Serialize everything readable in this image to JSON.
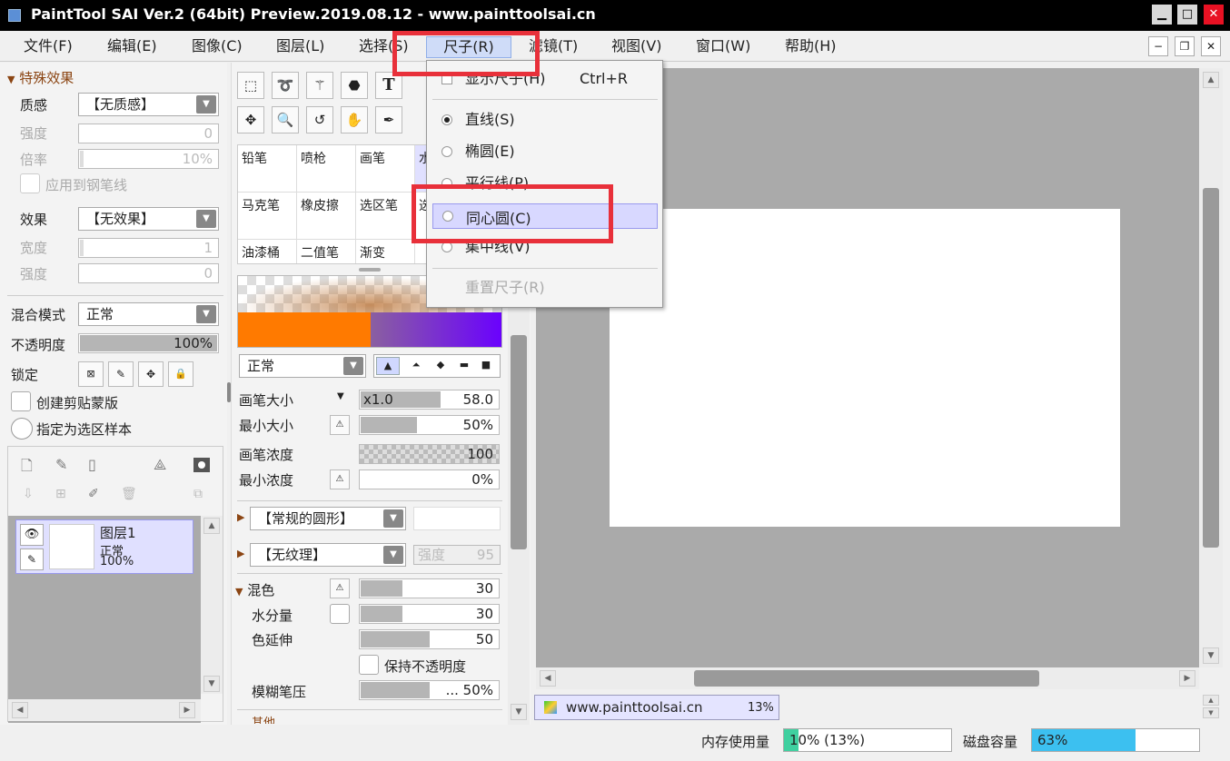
{
  "window": {
    "title": "PaintTool SAI Ver.2 (64bit) Preview.2019.08.12 - www.painttoolsai.cn",
    "min": "▁",
    "max": "□",
    "close": "✕"
  },
  "menu": [
    "文件(F)",
    "编辑(E)",
    "图像(C)",
    "图层(L)",
    "选择(S)",
    "尺子(R)",
    "滤镜(T)",
    "视图(V)",
    "窗口(W)",
    "帮助(H)"
  ],
  "mdi": {
    "min": "−",
    "restore": "❐",
    "close": "✕"
  },
  "effects": {
    "header": "特殊效果",
    "texture_label": "质感",
    "texture_value": "【无质感】",
    "strength_label": "强度",
    "strength_value": "0",
    "rate_label": "倍率",
    "rate_value": "10%",
    "apply_label": "应用到钢笔线",
    "effect_label": "效果",
    "effect_value": "【无效果】",
    "width_label": "宽度",
    "width_value": "1",
    "strength2_label": "强度",
    "strength2_value": "0"
  },
  "layer_props": {
    "blend_label": "混合模式",
    "blend_value": "正常",
    "opacity_label": "不透明度",
    "opacity_value": "100%",
    "opacity_fill": 1.0,
    "lock_label": "锁定",
    "clip_label": "创建剪贴蒙版",
    "select_label": "指定为选区样本"
  },
  "layer": {
    "name": "图层1",
    "mode": "正常",
    "opacity": "100%"
  },
  "tools": [
    "铅笔",
    "喷枪",
    "画笔",
    "水",
    "马克笔",
    "橡皮擦",
    "选区笔",
    "选",
    "油漆桶",
    "二值笔",
    "渐变"
  ],
  "brush": {
    "mode": "正常",
    "size_label": "画笔大小",
    "size_mult": "x1.0",
    "size_value": "58.0",
    "minsize_label": "最小大小",
    "minsize_value": "50%",
    "density_label": "画笔浓度",
    "density_value": "100",
    "mindensity_label": "最小浓度",
    "mindensity_value": "0%",
    "shape": "【常规的圆形】",
    "texture": "【无纹理】",
    "texture_strength_label": "强度",
    "texture_strength": "95",
    "mix_label": "混色",
    "mix_value": "30",
    "water_label": "水分量",
    "water_value": "30",
    "stretch_label": "色延伸",
    "stretch_value": "50",
    "keep_opacity_label": "保持不透明度",
    "blur_label": "模糊笔压",
    "blur_value": "... 50%",
    "other_label": "其他"
  },
  "ruler_menu": {
    "show": "显示尺子(H)",
    "show_shortcut": "Ctrl+R",
    "line": "直线(S)",
    "ellipse": "椭圆(E)",
    "parallel": "平行线(P)",
    "concentric": "同心圆(C)",
    "focus": "集中线(V)",
    "reset": "重置尺子(R)"
  },
  "canvas_tab": {
    "name": "www.painttoolsai.cn",
    "zoom": "13%"
  },
  "status": {
    "mem_label": "内存使用量",
    "mem_value": "10% (13%)",
    "mem_fill": 0.1,
    "disk_label": "磁盘容量",
    "disk_value": "63%",
    "disk_fill": 0.63
  },
  "colors": {
    "accent": "#cfdcf8",
    "highlight": "#e8303a",
    "memory": "#3fd0a0",
    "disk": "#3cc0f0"
  }
}
